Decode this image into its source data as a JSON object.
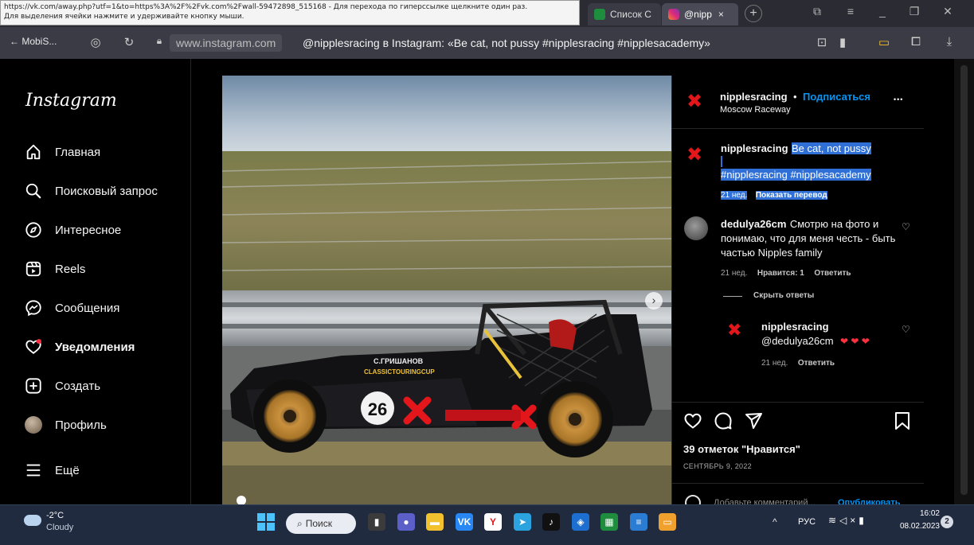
{
  "browser": {
    "status_url_line1": "https://vk.com/away.php?utf=1&to=https%3A%2F%2Fvk.com%2Fwall-59472898_515168 - Для перехода по гиперссылке щелкните один раз.",
    "status_url_line2": "Для выделения ячейки нажмите и удерживайте кнопку мыши.",
    "tabs": [
      {
        "label": "Список С"
      },
      {
        "label": "@nipp"
      }
    ],
    "tab_close": "×",
    "new_tab": "+",
    "back_label": "← MobiS...",
    "url": "www.instagram.com",
    "page_title": "@nipplesracing в Instagram: «Be cat, not pussy #nipplesracing #nipplesacademy»"
  },
  "instagram": {
    "logo": "Instagram",
    "nav": [
      {
        "label": "Главная",
        "icon": "home-icon"
      },
      {
        "label": "Поисковый запрос",
        "icon": "search-icon"
      },
      {
        "label": "Интересное",
        "icon": "compass-icon"
      },
      {
        "label": "Reels",
        "icon": "reels-icon"
      },
      {
        "label": "Сообщения",
        "icon": "messenger-icon"
      },
      {
        "label": "Уведомления",
        "icon": "heart-icon"
      },
      {
        "label": "Создать",
        "icon": "plus-square-icon"
      },
      {
        "label": "Профиль",
        "icon": "avatar"
      },
      {
        "label": "Ещё",
        "icon": "menu-icon"
      }
    ],
    "post": {
      "image_badge_number": "26",
      "car_text_driver": "C.ГРИШАНОВ",
      "car_text_sponsor": "CLASSICTOURINGCUP",
      "author": "nipplesracing",
      "dot": "•",
      "follow": "Подписаться",
      "location": "Moscow Raceway",
      "more": "•••",
      "caption_author": "nipplesracing",
      "caption_text": "Be cat, not pussy",
      "caption_tags": "#nipplesracing #nipplesacademy",
      "caption_time": "21 нед.",
      "show_translation": "Показать перевод",
      "comment_author": "dedulya26cm",
      "comment_text": "Смотрю на фото и понимаю, что для меня честь - быть частью Nipples family",
      "comment_time": "21 нед.",
      "comment_likes": "Нравится: 1",
      "reply_label": "Ответить",
      "hide_replies": "Скрыть ответы",
      "reply_author": "nipplesracing",
      "reply_text": "@dedulya26cm",
      "reply_hearts": "❤ ❤ ❤",
      "reply_time": "21 нед.",
      "likes": "39 отметок \"Нравится\"",
      "date": "СЕНТЯБРЬ 9, 2022",
      "add_comment": "Добавьте комментарий...",
      "publish": "Опубликовать"
    }
  },
  "taskbar": {
    "weather_temp": "-2°C",
    "weather_desc": "Cloudy",
    "search_label": "Поиск",
    "lang": "РУС",
    "time": "16:02",
    "date": "08.02.2023",
    "notification_count": "2",
    "apps": [
      {
        "name": "files-app",
        "glyph": "▮",
        "color": "#3b3b3b"
      },
      {
        "name": "teams-app",
        "glyph": "●",
        "color": "#5b5fc7"
      },
      {
        "name": "explorer-app",
        "glyph": "▬",
        "color": "#f2c12e"
      },
      {
        "name": "vk-app",
        "glyph": "VK",
        "color": "#2787f5"
      },
      {
        "name": "yandex-app",
        "glyph": "Y",
        "color": "#ffffff"
      },
      {
        "name": "telegram-app",
        "glyph": "➤",
        "color": "#2aa3df"
      },
      {
        "name": "tiktok-app",
        "glyph": "♪",
        "color": "#111111"
      },
      {
        "name": "defender-app",
        "glyph": "◈",
        "color": "#1c6fd1"
      },
      {
        "name": "sheets-app",
        "glyph": "▦",
        "color": "#1e8e3e"
      },
      {
        "name": "docs-app",
        "glyph": "≡",
        "color": "#2b7cd3"
      },
      {
        "name": "slides-app",
        "glyph": "▭",
        "color": "#f0a02c"
      }
    ]
  },
  "colors": {
    "selection": "#2f6fd6",
    "follow_blue": "#0095f6",
    "brand_red": "#e3161b"
  }
}
